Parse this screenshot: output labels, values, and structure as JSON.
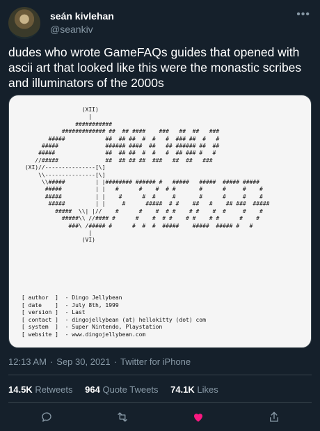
{
  "author": {
    "name": "seán kivlehan",
    "handle": "@seankiv"
  },
  "tweet": {
    "text": "dudes who wrote GameFAQs guides that opened with ascii art that looked like this were the monastic scribes and illuminators of the 2000s"
  },
  "media": {
    "ascii_lines": [
      "                  (XII)",
      "                    |",
      "                ###########",
      "            ############# ##  ## ####    ###   ##  ##   ###",
      "        #####            ##  ## ##  #  #   #  ### ##  #   #",
      "      #####              ###### ####  ##   ## ###### ##  ##",
      "     #####               ##  ## ##  #  #   #  ## ### #   #",
      "    //#####              ##  ## ## ##  ###   ##  ##   ###",
      " (XI)//---------------[\\]",
      "     \\\\---------------[\\]",
      "      \\\\#####         | |######## ###### #   #####   #####  ##### #####",
      "       #####          | |   #      #    #  # #       #      #     #    #",
      "       #####          | |    #      #  #     #       #      #     #    #",
      "        #####         | |     #      #####  # #    ##   #    ## ###  #####",
      "          #####  \\\\| |//    #      #    #  # #    # #    #  #     #    #",
      "            #####\\\\ //#### #      #    #  # #    # #    # #      #    #",
      "              ###\\ /##### #      #  #  #  #####    #####  ##### #   #",
      "                    |",
      "                  (VI)"
    ],
    "meta": [
      {
        "key": "author ",
        "value": "Dingo Jellybean"
      },
      {
        "key": "date   ",
        "value": "July 8th, 1999"
      },
      {
        "key": "version",
        "value": "Last"
      },
      {
        "key": "contact",
        "value": "dingojellybean (at) hellokitty (dot) com"
      },
      {
        "key": "system ",
        "value": "Super Nintendo, Playstation"
      },
      {
        "key": "website",
        "value": "www.dingojellybean.com"
      }
    ]
  },
  "timestamp": {
    "time": "12:13 AM",
    "date": "Sep 30, 2021",
    "source": "Twitter for iPhone"
  },
  "stats": {
    "retweets_count": "14.5K",
    "retweets_label": "Retweets",
    "quotes_count": "964",
    "quotes_label": "Quote Tweets",
    "likes_count": "74.1K",
    "likes_label": "Likes"
  },
  "colors": {
    "background": "#15202b",
    "muted": "#8899a6",
    "divider": "#38444d",
    "like": "#f91880"
  },
  "icons": {
    "reply": "reply-icon",
    "retweet": "retweet-icon",
    "like": "heart-icon",
    "share": "share-icon",
    "more": "more-icon"
  }
}
